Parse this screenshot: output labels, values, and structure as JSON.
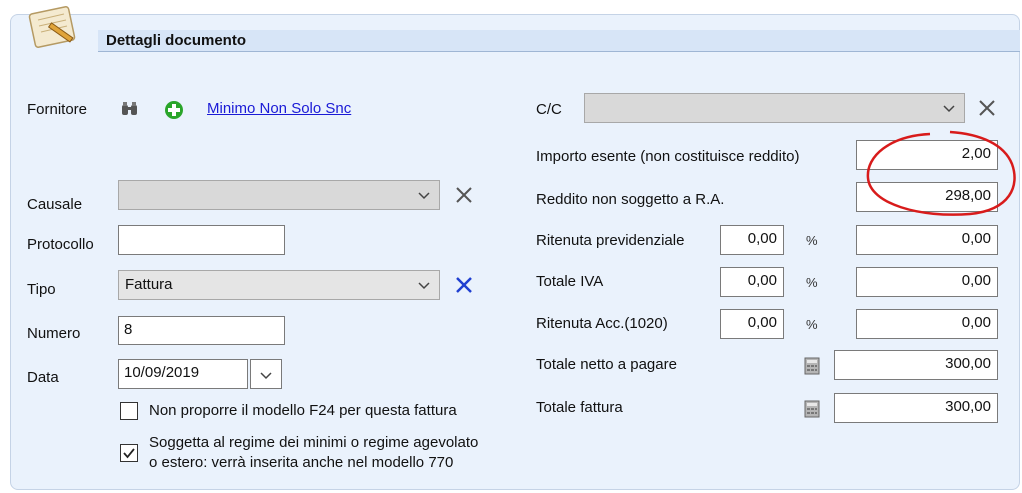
{
  "header": {
    "title": "Dettagli documento"
  },
  "left": {
    "fornitore_label": "Fornitore",
    "fornitore_link": "Minimo  Non Solo Snc",
    "causale_label": "Causale",
    "causale_value": "",
    "protocollo_label": "Protocollo",
    "protocollo_value": "",
    "tipo_label": "Tipo",
    "tipo_value": "Fattura",
    "numero_label": "Numero",
    "numero_value": "8",
    "data_label": "Data",
    "data_value": "10/09/2019",
    "chk_f24_label": "Non proporre il modello F24 per questa fattura",
    "chk_f24_checked": false,
    "chk_regime_label_1": "Soggetta al regime dei minimi o regime agevolato",
    "chk_regime_label_2": "o  estero: verrà inserita anche nel modello 770",
    "chk_regime_checked": true
  },
  "right": {
    "cc_label": "C/C",
    "cc_value": "",
    "importo_esente_label": "Importo esente (non costituisce reddito)",
    "importo_esente_value": "2,00",
    "reddito_label": "Reddito non soggetto a R.A.",
    "reddito_value": "298,00",
    "ritenuta_prev_label": "Ritenuta previdenziale",
    "ritenuta_prev_pct": "0,00",
    "ritenuta_prev_value": "0,00",
    "totale_iva_label": "Totale IVA",
    "totale_iva_pct": "0,00",
    "totale_iva_value": "0,00",
    "ritenuta_acc_label": "Ritenuta Acc.(1020)",
    "ritenuta_acc_pct": "0,00",
    "ritenuta_acc_value": "0,00",
    "percent_symbol": "%",
    "totale_netto_label": "Totale netto a pagare",
    "totale_netto_value": "300,00",
    "totale_fattura_label": "Totale fattura",
    "totale_fattura_value": "300,00"
  },
  "annotation": {
    "color": "#d81b1b"
  },
  "icons": {
    "header": "document-notepad-icon",
    "search": "binoculars-icon",
    "add": "add-green-icon",
    "clear": "close-icon",
    "dropdown": "chevron-down-icon",
    "calculator": "calculator-icon"
  }
}
